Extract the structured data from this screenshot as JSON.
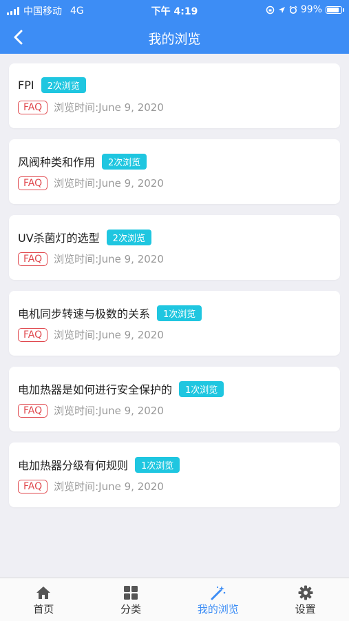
{
  "status_bar": {
    "carrier": "中国移动",
    "network": "4G",
    "time": "下午 4:19",
    "battery_percent": "99%",
    "battery_level": 0.99
  },
  "nav": {
    "title": "我的浏览"
  },
  "items": [
    {
      "title": "FPI",
      "views": "2次浏览",
      "tag": "FAQ",
      "time": "浏览时间:June 9, 2020"
    },
    {
      "title": "风阀种类和作用",
      "views": "2次浏览",
      "tag": "FAQ",
      "time": "浏览时间:June 9, 2020"
    },
    {
      "title": "UV杀菌灯的选型",
      "views": "2次浏览",
      "tag": "FAQ",
      "time": "浏览时间:June 9, 2020"
    },
    {
      "title": "电机同步转速与极数的关系",
      "views": "1次浏览",
      "tag": "FAQ",
      "time": "浏览时间:June 9, 2020"
    },
    {
      "title": "电加热器是如何进行安全保护的",
      "views": "1次浏览",
      "tag": "FAQ",
      "time": "浏览时间:June 9, 2020"
    },
    {
      "title": "电加热器分级有何规则",
      "views": "1次浏览",
      "tag": "FAQ",
      "time": "浏览时间:June 9, 2020"
    }
  ],
  "tabs": [
    {
      "label": "首页",
      "icon": "home-icon",
      "active": false
    },
    {
      "label": "分类",
      "icon": "grid-icon",
      "active": false
    },
    {
      "label": "我的浏览",
      "icon": "magic-wand-icon",
      "active": true
    },
    {
      "label": "设置",
      "icon": "gear-icon",
      "active": false
    }
  ],
  "colors": {
    "primary": "#3d8df5",
    "badge": "#1fc6e0",
    "tag": "#e0484e",
    "background": "#efeff4"
  }
}
